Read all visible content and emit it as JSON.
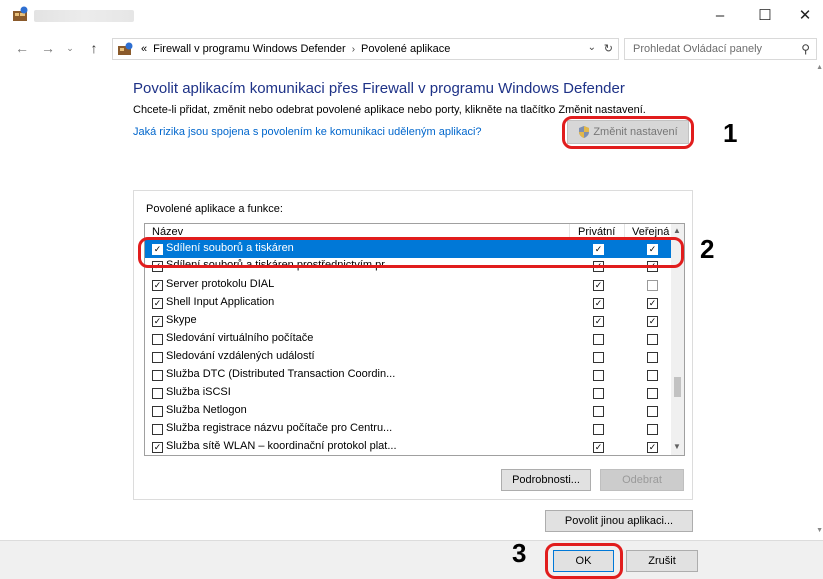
{
  "window": {
    "minimize": "–",
    "maximize": "☐",
    "close": "✕"
  },
  "address": {
    "prefix": "«",
    "crumbs": [
      "Firewall v programu Windows Defender",
      "Povolené aplikace"
    ],
    "separator": "›",
    "dropdown": "⌄",
    "refresh": "↻"
  },
  "search": {
    "placeholder": "Prohledat Ovládací panely"
  },
  "content": {
    "heading": "Povolit aplikacím komunikaci přes Firewall v programu Windows Defender",
    "description": "Chcete-li přidat, změnit nebo odebrat povolené aplikace nebo porty, klikněte na tlačítko Změnit nastavení.",
    "risk_link": "Jaká rizika jsou spojena s povolením ke komunikaci uděleným aplikaci?",
    "change_settings": "Změnit nastavení"
  },
  "group": {
    "title": "Povolené aplikace a funkce:",
    "columns": {
      "name": "Název",
      "private": "Privátní",
      "public": "Veřejná"
    },
    "rows": [
      {
        "name": "Sdílení souborů a tiskáren",
        "checked": true,
        "private": true,
        "public": true,
        "selected": true
      },
      {
        "name": "Sdílení souborů a tiskáren prostřednictvím pr...",
        "checked": true,
        "private": true,
        "public": true,
        "selected": false
      },
      {
        "name": "Server protokolu DIAL",
        "checked": true,
        "private": true,
        "public": false,
        "selected": false
      },
      {
        "name": "Shell Input Application",
        "checked": true,
        "private": true,
        "public": true,
        "selected": false
      },
      {
        "name": "Skype",
        "checked": true,
        "private": true,
        "public": true,
        "selected": false
      },
      {
        "name": "Sledování virtuálního počítače",
        "checked": false,
        "private": false,
        "public": false,
        "selected": false
      },
      {
        "name": "Sledování vzdálených událostí",
        "checked": false,
        "private": false,
        "public": false,
        "selected": false
      },
      {
        "name": "Služba DTC (Distributed Transaction Coordin...",
        "checked": false,
        "private": false,
        "public": false,
        "selected": false
      },
      {
        "name": "Služba iSCSI",
        "checked": false,
        "private": false,
        "public": false,
        "selected": false
      },
      {
        "name": "Služba Netlogon",
        "checked": false,
        "private": false,
        "public": false,
        "selected": false
      },
      {
        "name": "Služba registrace názvu počítače pro Centru...",
        "checked": false,
        "private": false,
        "public": false,
        "selected": false
      },
      {
        "name": "Služba sítě WLAN – koordinační protokol plat...",
        "checked": true,
        "private": true,
        "public": true,
        "selected": false
      }
    ],
    "details": "Podrobnosti...",
    "remove": "Odebrat"
  },
  "allow_other": "Povolit jinou aplikaci...",
  "footer": {
    "ok": "OK",
    "cancel": "Zrušit"
  },
  "callouts": [
    "1",
    "2",
    "3"
  ],
  "colors": {
    "heading": "#1e3287",
    "link": "#0066cc",
    "selection": "#0078d7",
    "callout": "#e11d1d"
  },
  "icons": [
    "app-icon",
    "back-arrow-icon",
    "forward-arrow-icon",
    "recent-dropdown-icon",
    "up-arrow-icon",
    "control-panel-icon",
    "search-icon",
    "shield-icon",
    "checkbox-icon"
  ]
}
